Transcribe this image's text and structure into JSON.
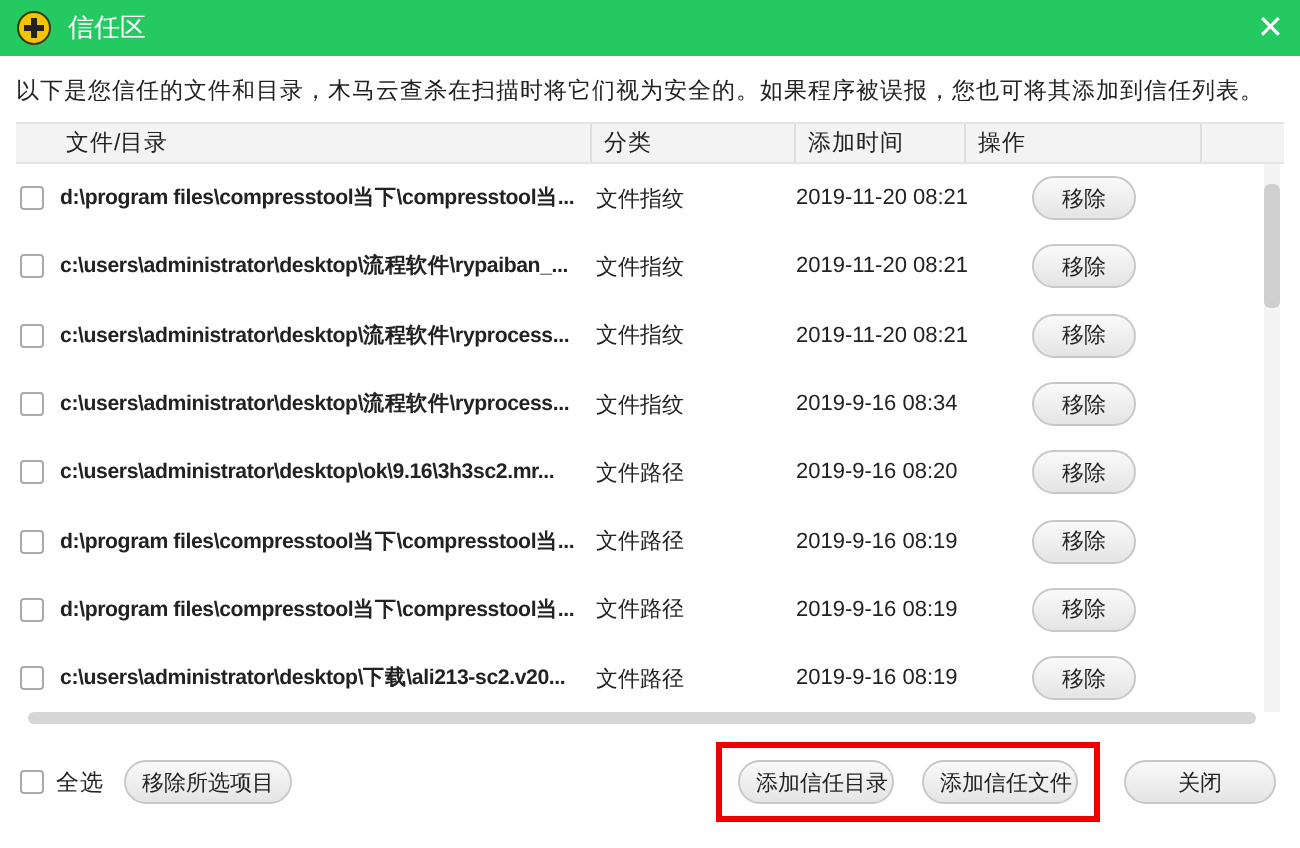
{
  "window": {
    "title": "信任区",
    "close_glyph": "✕"
  },
  "description": "以下是您信任的文件和目录，木马云查杀在扫描时将它们视为安全的。如果程序被误报，您也可将其添加到信任列表。",
  "table": {
    "columns": [
      "文件/目录",
      "分类",
      "添加时间",
      "操作"
    ],
    "rows": [
      {
        "checked": false,
        "path": "d:\\program files\\compresstool当下\\compresstool当...",
        "category": "文件指纹",
        "time": "2019-11-20 08:21",
        "action": "移除"
      },
      {
        "checked": false,
        "path": "c:\\users\\administrator\\desktop\\流程软件\\rypaiban_...",
        "category": "文件指纹",
        "time": "2019-11-20 08:21",
        "action": "移除"
      },
      {
        "checked": false,
        "path": "c:\\users\\administrator\\desktop\\流程软件\\ryprocess...",
        "category": "文件指纹",
        "time": "2019-11-20 08:21",
        "action": "移除"
      },
      {
        "checked": false,
        "path": "c:\\users\\administrator\\desktop\\流程软件\\ryprocess...",
        "category": "文件指纹",
        "time": "2019-9-16 08:34",
        "action": "移除"
      },
      {
        "checked": false,
        "path": "c:\\users\\administrator\\desktop\\ok\\9.16\\3h3sc2.mr...",
        "category": "文件路径",
        "time": "2019-9-16 08:20",
        "action": "移除"
      },
      {
        "checked": false,
        "path": "d:\\program files\\compresstool当下\\compresstool当...",
        "category": "文件路径",
        "time": "2019-9-16 08:19",
        "action": "移除"
      },
      {
        "checked": false,
        "path": "d:\\program files\\compresstool当下\\compresstool当...",
        "category": "文件路径",
        "time": "2019-9-16 08:19",
        "action": "移除"
      },
      {
        "checked": false,
        "path": "c:\\users\\administrator\\desktop\\下载\\ali213-sc2.v20...",
        "category": "文件路径",
        "time": "2019-9-16 08:19",
        "action": "移除"
      }
    ]
  },
  "footer": {
    "select_all": {
      "label": "全选",
      "checked": false
    },
    "remove_selected": "移除所选项目",
    "buttons": [
      "添加信任目录",
      "添加信任文件",
      "关闭"
    ]
  }
}
